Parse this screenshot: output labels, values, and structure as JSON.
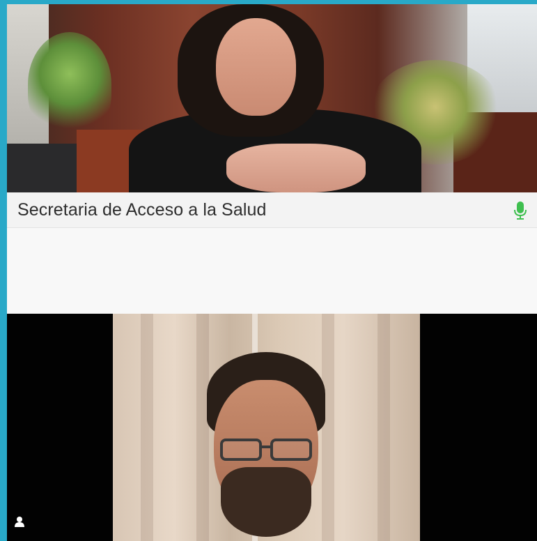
{
  "participants": [
    {
      "name": "Secretaria de Acceso a la Salud",
      "mic_icon": "microphone-icon",
      "mic_color": "#3fbf4f"
    },
    {
      "name": "",
      "status_icon": "person-icon"
    }
  ],
  "colors": {
    "frame": "#29a9c8",
    "name_bar": "#f3f3f3",
    "tile_background": "#020202"
  }
}
